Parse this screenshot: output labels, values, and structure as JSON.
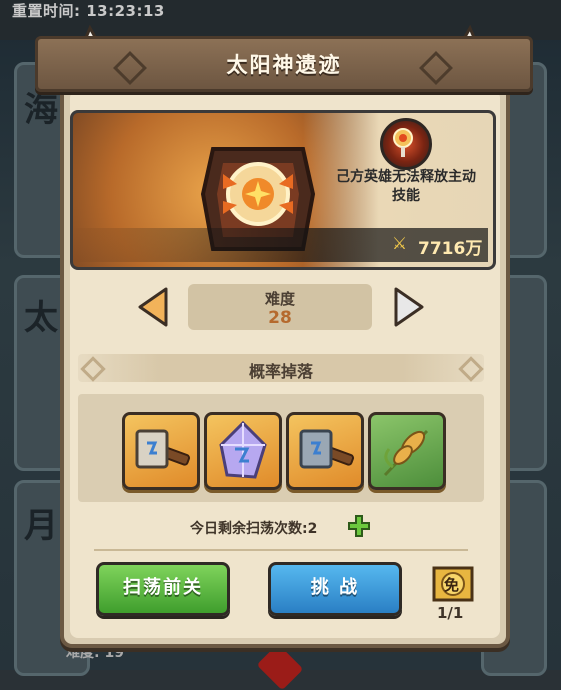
{
  "header": {
    "reset_time": "重置时间: 13:23:13"
  },
  "background": {
    "bottom_text": "难度: 19",
    "side_chars": [
      "海",
      "太",
      "月"
    ]
  },
  "dialog": {
    "title": "太阳神遗迹",
    "stage": {
      "debuff_text": "己方英雄无法释放主动技能",
      "power": "7716万"
    },
    "difficulty": {
      "label": "难度",
      "value": "28"
    },
    "drops": {
      "title": "概率掉落",
      "items": [
        {
          "name": "stone-hammer",
          "color": "orange"
        },
        {
          "name": "crystal-rune",
          "color": "orange"
        },
        {
          "name": "iron-hammer",
          "color": "orange"
        },
        {
          "name": "wheat",
          "color": "green"
        }
      ]
    },
    "sweep_count": "今日剩余扫荡次数:2",
    "buttons": {
      "sweep": "扫荡前关",
      "challenge": "挑 战"
    },
    "free": {
      "badge": "免",
      "count": "1/1"
    }
  },
  "colors": {
    "sweep": "#3f9e2d",
    "challenge": "#2a7fc4",
    "title_banner": "#6d5641",
    "power": "#ffe9b0"
  }
}
